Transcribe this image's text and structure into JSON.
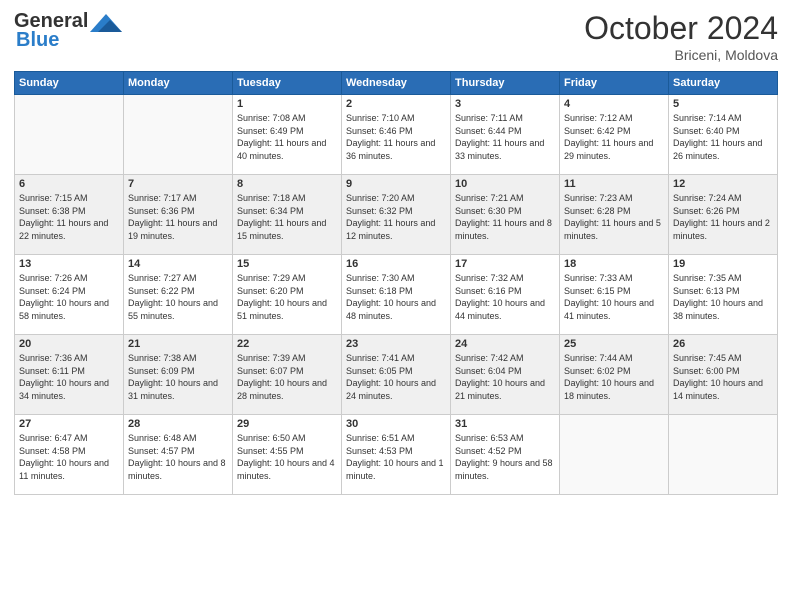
{
  "header": {
    "logo_line1": "General",
    "logo_line2": "Blue",
    "month": "October 2024",
    "location": "Briceni, Moldova"
  },
  "days_of_week": [
    "Sunday",
    "Monday",
    "Tuesday",
    "Wednesday",
    "Thursday",
    "Friday",
    "Saturday"
  ],
  "weeks": [
    [
      {
        "num": "",
        "info": ""
      },
      {
        "num": "",
        "info": ""
      },
      {
        "num": "1",
        "info": "Sunrise: 7:08 AM\nSunset: 6:49 PM\nDaylight: 11 hours and 40 minutes."
      },
      {
        "num": "2",
        "info": "Sunrise: 7:10 AM\nSunset: 6:46 PM\nDaylight: 11 hours and 36 minutes."
      },
      {
        "num": "3",
        "info": "Sunrise: 7:11 AM\nSunset: 6:44 PM\nDaylight: 11 hours and 33 minutes."
      },
      {
        "num": "4",
        "info": "Sunrise: 7:12 AM\nSunset: 6:42 PM\nDaylight: 11 hours and 29 minutes."
      },
      {
        "num": "5",
        "info": "Sunrise: 7:14 AM\nSunset: 6:40 PM\nDaylight: 11 hours and 26 minutes."
      }
    ],
    [
      {
        "num": "6",
        "info": "Sunrise: 7:15 AM\nSunset: 6:38 PM\nDaylight: 11 hours and 22 minutes."
      },
      {
        "num": "7",
        "info": "Sunrise: 7:17 AM\nSunset: 6:36 PM\nDaylight: 11 hours and 19 minutes."
      },
      {
        "num": "8",
        "info": "Sunrise: 7:18 AM\nSunset: 6:34 PM\nDaylight: 11 hours and 15 minutes."
      },
      {
        "num": "9",
        "info": "Sunrise: 7:20 AM\nSunset: 6:32 PM\nDaylight: 11 hours and 12 minutes."
      },
      {
        "num": "10",
        "info": "Sunrise: 7:21 AM\nSunset: 6:30 PM\nDaylight: 11 hours and 8 minutes."
      },
      {
        "num": "11",
        "info": "Sunrise: 7:23 AM\nSunset: 6:28 PM\nDaylight: 11 hours and 5 minutes."
      },
      {
        "num": "12",
        "info": "Sunrise: 7:24 AM\nSunset: 6:26 PM\nDaylight: 11 hours and 2 minutes."
      }
    ],
    [
      {
        "num": "13",
        "info": "Sunrise: 7:26 AM\nSunset: 6:24 PM\nDaylight: 10 hours and 58 minutes."
      },
      {
        "num": "14",
        "info": "Sunrise: 7:27 AM\nSunset: 6:22 PM\nDaylight: 10 hours and 55 minutes."
      },
      {
        "num": "15",
        "info": "Sunrise: 7:29 AM\nSunset: 6:20 PM\nDaylight: 10 hours and 51 minutes."
      },
      {
        "num": "16",
        "info": "Sunrise: 7:30 AM\nSunset: 6:18 PM\nDaylight: 10 hours and 48 minutes."
      },
      {
        "num": "17",
        "info": "Sunrise: 7:32 AM\nSunset: 6:16 PM\nDaylight: 10 hours and 44 minutes."
      },
      {
        "num": "18",
        "info": "Sunrise: 7:33 AM\nSunset: 6:15 PM\nDaylight: 10 hours and 41 minutes."
      },
      {
        "num": "19",
        "info": "Sunrise: 7:35 AM\nSunset: 6:13 PM\nDaylight: 10 hours and 38 minutes."
      }
    ],
    [
      {
        "num": "20",
        "info": "Sunrise: 7:36 AM\nSunset: 6:11 PM\nDaylight: 10 hours and 34 minutes."
      },
      {
        "num": "21",
        "info": "Sunrise: 7:38 AM\nSunset: 6:09 PM\nDaylight: 10 hours and 31 minutes."
      },
      {
        "num": "22",
        "info": "Sunrise: 7:39 AM\nSunset: 6:07 PM\nDaylight: 10 hours and 28 minutes."
      },
      {
        "num": "23",
        "info": "Sunrise: 7:41 AM\nSunset: 6:05 PM\nDaylight: 10 hours and 24 minutes."
      },
      {
        "num": "24",
        "info": "Sunrise: 7:42 AM\nSunset: 6:04 PM\nDaylight: 10 hours and 21 minutes."
      },
      {
        "num": "25",
        "info": "Sunrise: 7:44 AM\nSunset: 6:02 PM\nDaylight: 10 hours and 18 minutes."
      },
      {
        "num": "26",
        "info": "Sunrise: 7:45 AM\nSunset: 6:00 PM\nDaylight: 10 hours and 14 minutes."
      }
    ],
    [
      {
        "num": "27",
        "info": "Sunrise: 6:47 AM\nSunset: 4:58 PM\nDaylight: 10 hours and 11 minutes."
      },
      {
        "num": "28",
        "info": "Sunrise: 6:48 AM\nSunset: 4:57 PM\nDaylight: 10 hours and 8 minutes."
      },
      {
        "num": "29",
        "info": "Sunrise: 6:50 AM\nSunset: 4:55 PM\nDaylight: 10 hours and 4 minutes."
      },
      {
        "num": "30",
        "info": "Sunrise: 6:51 AM\nSunset: 4:53 PM\nDaylight: 10 hours and 1 minute."
      },
      {
        "num": "31",
        "info": "Sunrise: 6:53 AM\nSunset: 4:52 PM\nDaylight: 9 hours and 58 minutes."
      },
      {
        "num": "",
        "info": ""
      },
      {
        "num": "",
        "info": ""
      }
    ]
  ]
}
